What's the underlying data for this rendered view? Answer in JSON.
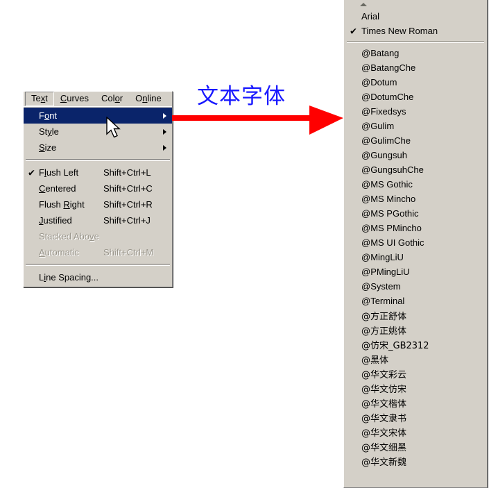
{
  "text_menu": {
    "menubar": [
      {
        "label": "Text",
        "mnemonic_index": 2,
        "pressed": true
      },
      {
        "label": "Curves",
        "mnemonic_index": 0,
        "pressed": false
      },
      {
        "label": "Color",
        "mnemonic_index": 3,
        "pressed": false
      },
      {
        "label": "Online",
        "mnemonic_index": 1,
        "pressed": false
      }
    ],
    "items": [
      {
        "label": "Font",
        "accel": "",
        "checked": false,
        "disabled": false,
        "selected": true,
        "submenu": true,
        "mnemonic_index": 1
      },
      {
        "label": "Style",
        "accel": "",
        "checked": false,
        "disabled": false,
        "selected": false,
        "submenu": true,
        "mnemonic_index": 2
      },
      {
        "label": "Size",
        "accel": "",
        "checked": false,
        "disabled": false,
        "selected": false,
        "submenu": true,
        "mnemonic_index": 0
      },
      {
        "separator": true
      },
      {
        "label": "Flush Left",
        "accel": "Shift+Ctrl+L",
        "checked": true,
        "disabled": false,
        "selected": false,
        "submenu": false,
        "mnemonic_index": 1
      },
      {
        "label": "Centered",
        "accel": "Shift+Ctrl+C",
        "checked": false,
        "disabled": false,
        "selected": false,
        "submenu": false,
        "mnemonic_index": 0
      },
      {
        "label": "Flush Right",
        "accel": "Shift+Ctrl+R",
        "checked": false,
        "disabled": false,
        "selected": false,
        "submenu": false,
        "mnemonic_index": 6
      },
      {
        "label": "Justified",
        "accel": "Shift+Ctrl+J",
        "checked": false,
        "disabled": false,
        "selected": false,
        "submenu": false,
        "mnemonic_index": 0
      },
      {
        "label": "Stacked Above",
        "accel": "",
        "checked": false,
        "disabled": true,
        "selected": false,
        "submenu": false,
        "mnemonic_index": 11
      },
      {
        "label": "Automatic",
        "accel": "Shift+Ctrl+M",
        "checked": false,
        "disabled": true,
        "selected": false,
        "submenu": false,
        "mnemonic_index": 0
      },
      {
        "separator": true
      },
      {
        "label": "Line Spacing...",
        "accel": "",
        "checked": false,
        "disabled": false,
        "selected": false,
        "submenu": false,
        "mnemonic_index": 1
      }
    ]
  },
  "annotation": {
    "text": "文本字体",
    "text_color": "#1818ff",
    "arrow_color": "#ff0000",
    "arrow_icon": "right-arrow-icon"
  },
  "font_list": {
    "scroll_up_icon": "scroll-up-arrow-icon",
    "checkmark": "✔",
    "items": [
      {
        "label": "Arial",
        "checked": false
      },
      {
        "label": "Times New Roman",
        "checked": true
      },
      {
        "separator": true
      },
      {
        "label": "@Batang",
        "checked": false
      },
      {
        "label": "@BatangChe",
        "checked": false
      },
      {
        "label": "@Dotum",
        "checked": false
      },
      {
        "label": "@DotumChe",
        "checked": false
      },
      {
        "label": "@Fixedsys",
        "checked": false
      },
      {
        "label": "@Gulim",
        "checked": false
      },
      {
        "label": "@GulimChe",
        "checked": false
      },
      {
        "label": "@Gungsuh",
        "checked": false
      },
      {
        "label": "@GungsuhChe",
        "checked": false
      },
      {
        "label": "@MS Gothic",
        "checked": false
      },
      {
        "label": "@MS Mincho",
        "checked": false
      },
      {
        "label": "@MS PGothic",
        "checked": false
      },
      {
        "label": "@MS PMincho",
        "checked": false
      },
      {
        "label": "@MS UI Gothic",
        "checked": false
      },
      {
        "label": "@MingLiU",
        "checked": false
      },
      {
        "label": "@PMingLiU",
        "checked": false
      },
      {
        "label": "@System",
        "checked": false
      },
      {
        "label": "@Terminal",
        "checked": false
      },
      {
        "label": "@方正舒体",
        "checked": false
      },
      {
        "label": "@方正姚体",
        "checked": false
      },
      {
        "label": "@仿宋_GB2312",
        "checked": false
      },
      {
        "label": "@黑体",
        "checked": false
      },
      {
        "label": "@华文彩云",
        "checked": false
      },
      {
        "label": "@华文仿宋",
        "checked": false
      },
      {
        "label": "@华文楷体",
        "checked": false
      },
      {
        "label": "@华文隶书",
        "checked": false
      },
      {
        "label": "@华文宋体",
        "checked": false
      },
      {
        "label": "@华文细黑",
        "checked": false
      },
      {
        "label": "@华文新魏",
        "checked": false
      }
    ]
  }
}
